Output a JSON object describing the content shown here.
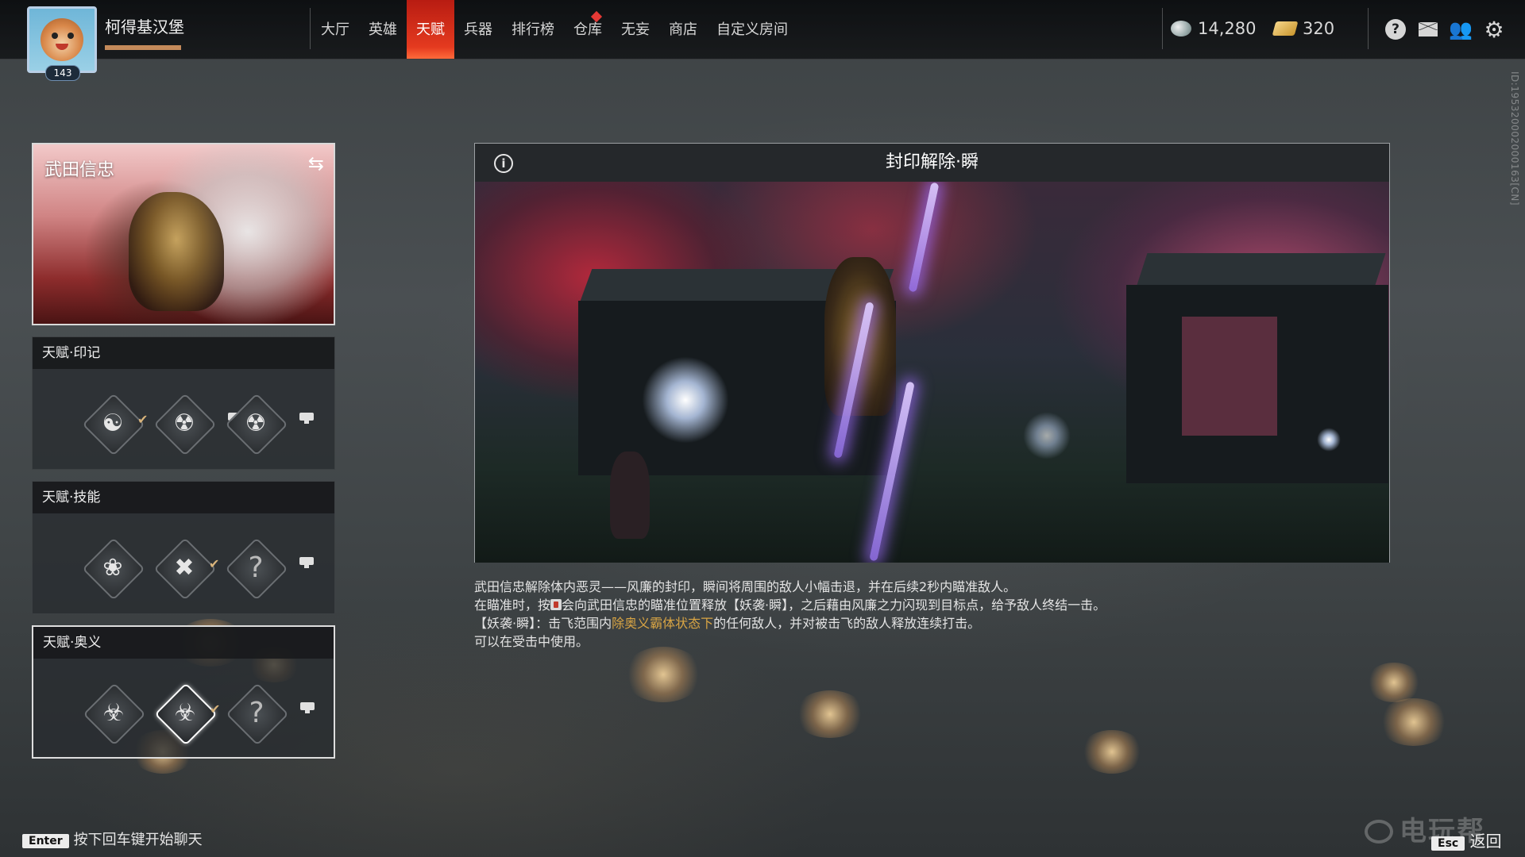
{
  "player": {
    "name": "柯得基汉堡",
    "level": "143"
  },
  "nav": {
    "items": [
      {
        "label": "大厅",
        "active": false
      },
      {
        "label": "英雄",
        "active": false
      },
      {
        "label": "天赋",
        "active": true
      },
      {
        "label": "兵器",
        "active": false
      },
      {
        "label": "排行榜",
        "active": false
      },
      {
        "label": "仓库",
        "active": false,
        "notification": true
      },
      {
        "label": "无妄",
        "active": false
      },
      {
        "label": "商店",
        "active": false
      },
      {
        "label": "自定义房间",
        "active": false
      }
    ]
  },
  "currency": {
    "coins": "14,280",
    "coins_icon": "coin-icon",
    "tickets": "320",
    "tickets_icon": "ticket-icon"
  },
  "system_icons": [
    "help-icon",
    "mail-icon",
    "friends-icon",
    "gear-icon"
  ],
  "side_id": "ID:195320002000163[CN]",
  "hero": {
    "name": "武田信忠",
    "swap_icon": "swap-icon"
  },
  "talents": {
    "mark": {
      "title": "天赋·印记",
      "slots": [
        {
          "icon": "tomoe-icon",
          "equipped": true,
          "locked": false
        },
        {
          "icon": "oni-mask-1-icon",
          "equipped": false,
          "locked": true
        },
        {
          "icon": "oni-mask-2-icon",
          "equipped": false,
          "locked": true
        }
      ]
    },
    "skill": {
      "title": "天赋·技能",
      "slots": [
        {
          "icon": "swirl-icon",
          "equipped": false,
          "locked": false
        },
        {
          "icon": "dash-slash-icon",
          "equipped": true,
          "locked": false
        },
        {
          "icon": "unknown-icon",
          "label": "?",
          "equipped": false,
          "locked": true
        }
      ]
    },
    "ultimate": {
      "title": "天赋·奥义",
      "slots": [
        {
          "icon": "demon-mask-icon",
          "equipped": false,
          "locked": false
        },
        {
          "icon": "demon-mask-horned-icon",
          "equipped": true,
          "selected": true,
          "locked": false
        },
        {
          "icon": "unknown-icon",
          "label": "?",
          "equipped": false,
          "locked": true
        }
      ]
    }
  },
  "detail": {
    "title": "封印解除·瞬",
    "desc_line1": "武田信忠解除体内恶灵——风廉的封印，瞬间将周围的敌人小幅击退，并在后续2秒内瞄准敌人。",
    "desc_line2_a": "在瞄准时，按",
    "desc_line2_b": "会向武田信忠的瞄准位置释放【妖袭·瞬】，之后藉由风廉之力闪现到目标点，给予敌人终结一击。",
    "desc_line3_a": "【妖袭·瞬】：击飞范围内",
    "desc_line3_highlight": "除奥义霸体状态下",
    "desc_line3_b": "的任何敌人，并对被击飞的敌人释放连续打击。",
    "desc_line4": "可以在受击中使用。",
    "highlight_color": "#d9a544"
  },
  "footer": {
    "chat_key": "Enter",
    "chat_hint": "按下回车键开始聊天",
    "back_key": "Esc",
    "back_label": "返回",
    "watermark": "电玩帮"
  },
  "colors": {
    "accent_red": "#e43a1f",
    "gold": "#d9b47b"
  }
}
